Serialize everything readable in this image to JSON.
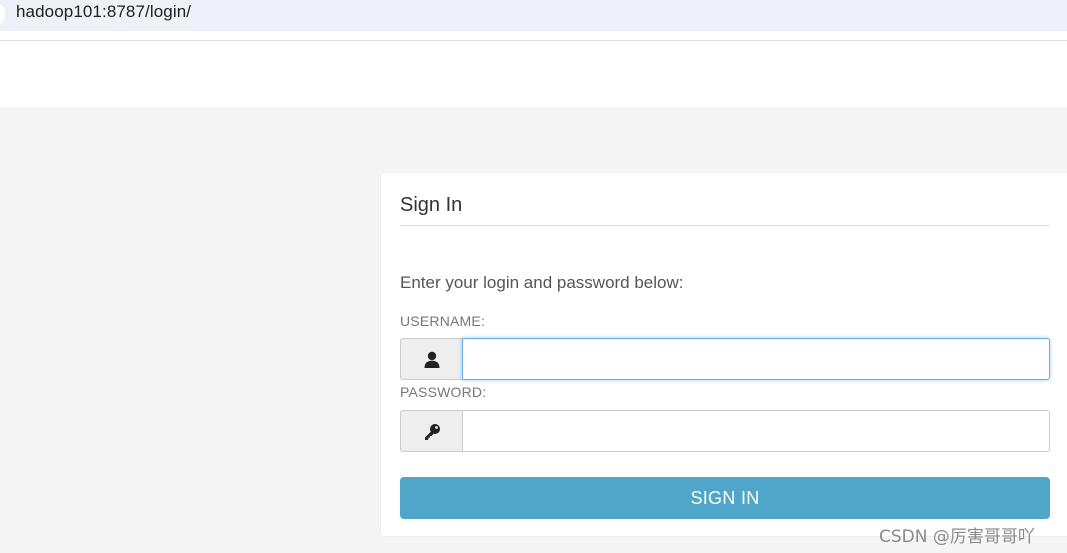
{
  "browser": {
    "url": "hadoop101:8787/login/"
  },
  "login": {
    "title": "Sign In",
    "instructions": "Enter your login and password below:",
    "username_label": "USERNAME:",
    "username_value": "",
    "username_icon": "user-icon",
    "password_label": "PASSWORD:",
    "password_value": "",
    "password_icon": "key-icon",
    "submit_label": "SIGN IN"
  },
  "watermark": "CSDN @厉害哥哥吖",
  "colors": {
    "background": "#f5f5f5",
    "card": "#ffffff",
    "button": "#4fa6c9",
    "focus_ring": "#66afe9"
  }
}
